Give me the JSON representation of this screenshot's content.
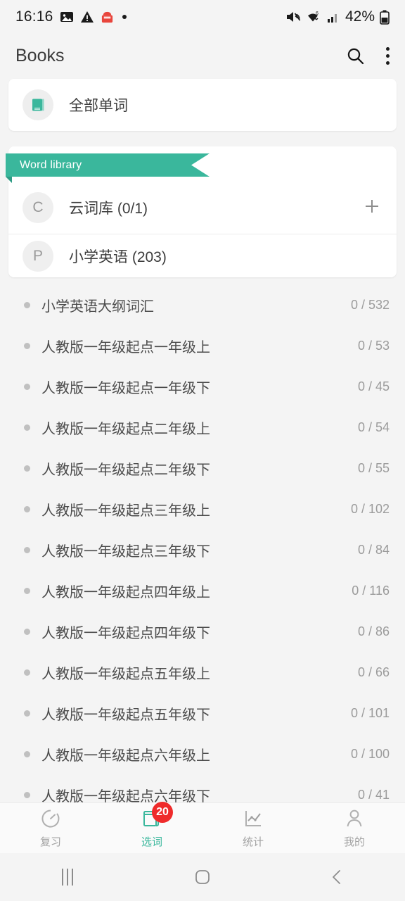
{
  "status_bar": {
    "time": "16:16",
    "battery_percent": "42%",
    "icons": [
      "image-icon",
      "warning-icon",
      "app-notification-icon",
      "dot-icon",
      "mute-icon",
      "wifi-icon",
      "signal-icon",
      "battery-icon"
    ]
  },
  "app_bar": {
    "title": "Books",
    "search_icon": "search-icon",
    "overflow_icon": "more-vertical-icon"
  },
  "all_words_card": {
    "label": "全部单词",
    "icon": "book-icon"
  },
  "library_card": {
    "ribbon_label": "Word library",
    "rows": [
      {
        "avatar": "C",
        "label": "云词库 (0/1)",
        "action_icon": "plus-icon"
      },
      {
        "avatar": "P",
        "label": "小学英语 (203)"
      }
    ]
  },
  "book_list": [
    {
      "label": "小学英语大纲词汇",
      "count": "0 / 532"
    },
    {
      "label": "人教版一年级起点一年级上",
      "count": "0 / 53"
    },
    {
      "label": "人教版一年级起点一年级下",
      "count": "0 / 45"
    },
    {
      "label": "人教版一年级起点二年级上",
      "count": "0 / 54"
    },
    {
      "label": "人教版一年级起点二年级下",
      "count": "0 / 55"
    },
    {
      "label": "人教版一年级起点三年级上",
      "count": "0 / 102"
    },
    {
      "label": "人教版一年级起点三年级下",
      "count": "0 / 84"
    },
    {
      "label": "人教版一年级起点四年级上",
      "count": "0 / 116"
    },
    {
      "label": "人教版一年级起点四年级下",
      "count": "0 / 86"
    },
    {
      "label": "人教版一年级起点五年级上",
      "count": "0 / 66"
    },
    {
      "label": "人教版一年级起点五年级下",
      "count": "0 / 101"
    },
    {
      "label": "人教版一年级起点六年级上",
      "count": "0 / 100"
    },
    {
      "label": "人教版一年级起点六年级下",
      "count": "0 / 41"
    }
  ],
  "bottom_nav": {
    "items": [
      {
        "label": "复习",
        "icon": "clock-icon",
        "active": false
      },
      {
        "label": "选词",
        "icon": "book-icon",
        "active": true,
        "badge": "20"
      },
      {
        "label": "统计",
        "icon": "chart-icon",
        "active": false
      },
      {
        "label": "我的",
        "icon": "person-icon",
        "active": false
      }
    ]
  },
  "system_nav": {
    "recents": "recents-icon",
    "home": "home-icon",
    "back": "back-icon"
  },
  "colors": {
    "accent": "#3ab79c",
    "badge": "#ef2b2b",
    "background": "#f4f4f4",
    "card": "#ffffff"
  }
}
